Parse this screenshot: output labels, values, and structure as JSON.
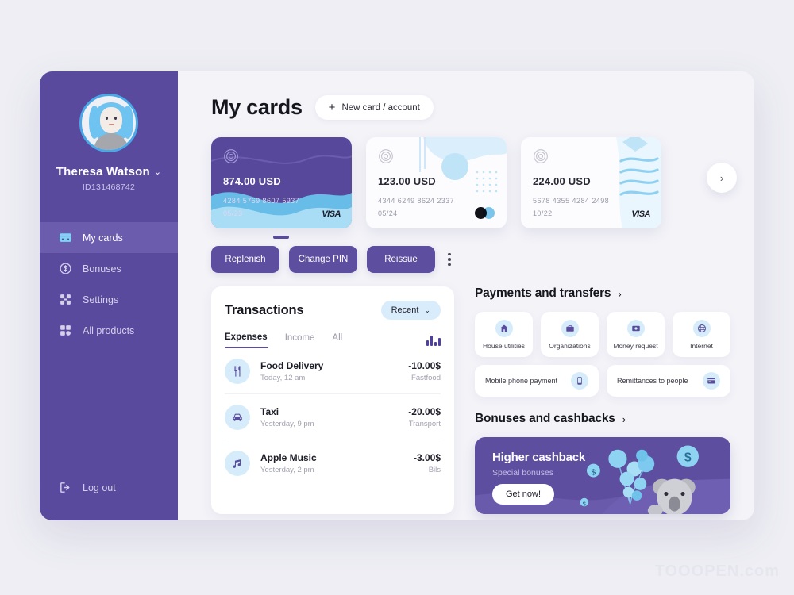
{
  "sidebar": {
    "user_name": "Theresa Watson",
    "user_id": "ID131468742",
    "chevron": "⌄",
    "items": [
      {
        "label": "My cards",
        "icon": "card-icon"
      },
      {
        "label": "Bonuses",
        "icon": "coin-dollar-icon"
      },
      {
        "label": "Settings",
        "icon": "settings-icon"
      },
      {
        "label": "All products",
        "icon": "grid-icon"
      }
    ],
    "logout": {
      "label": "Log out",
      "icon": "logout-icon"
    }
  },
  "header": {
    "title": "My cards",
    "new_card_label": "New card / account",
    "plus": "+"
  },
  "cards": [
    {
      "balance": "874.00 USD",
      "number": "4284 5769 8607 5937",
      "expiry": "05/23",
      "brand": "VISA"
    },
    {
      "balance": "123.00 USD",
      "number": "4344 6249 8624 2337",
      "expiry": "05/24",
      "brand": "mastercard"
    },
    {
      "balance": "224.00 USD",
      "number": "5678 4355 4284 2498",
      "expiry": "10/22",
      "brand": "VISA"
    }
  ],
  "carousel": {
    "next": "›"
  },
  "actions": [
    {
      "label": "Replenish"
    },
    {
      "label": "Change PIN"
    },
    {
      "label": "Reissue"
    }
  ],
  "transactions": {
    "title": "Transactions",
    "filter_label": "Recent",
    "filter_chevron": "⌄",
    "tabs": [
      {
        "label": "Expenses",
        "active": true
      },
      {
        "label": "Income",
        "active": false
      },
      {
        "label": "All",
        "active": false
      }
    ],
    "chart_icon": "bar-chart-icon",
    "rows": [
      {
        "name": "Food Delivery",
        "date": "Today, 12 am",
        "amount": "-10.00$",
        "category": "Fastfood",
        "icon": "cutlery-icon"
      },
      {
        "name": "Taxi",
        "date": "Yesterday, 9 pm",
        "amount": "-20.00$",
        "category": "Transport",
        "icon": "car-icon"
      },
      {
        "name": "Apple Music",
        "date": "Yesterday, 2 pm",
        "amount": "-3.00$",
        "category": "Bils",
        "icon": "music-note-icon"
      }
    ]
  },
  "payments": {
    "title": "Payments and transfers",
    "arrow": "›",
    "tiles": [
      {
        "label": "House utilities",
        "icon": "house-icon"
      },
      {
        "label": "Organizations",
        "icon": "briefcase-icon"
      },
      {
        "label": "Money request",
        "icon": "money-icon"
      },
      {
        "label": "Internet",
        "icon": "globe-icon"
      }
    ],
    "rows": [
      {
        "label": "Mobile phone payment",
        "icon": "phone-icon"
      },
      {
        "label": "Remittances to people",
        "icon": "card-icon"
      }
    ]
  },
  "bonuses": {
    "title": "Bonuses and cashbacks",
    "arrow": "›",
    "banner": {
      "title": "Higher cashback",
      "subtitle": "Special bonuses",
      "button": "Get now!"
    }
  },
  "watermark": "TOOOPEN.com",
  "colors": {
    "sidebar": "#594a9e",
    "accent": "#5d4e9f",
    "card_primary": "#57489b",
    "icon_bg": "#d6ecfb",
    "background": "#eeeef4"
  }
}
